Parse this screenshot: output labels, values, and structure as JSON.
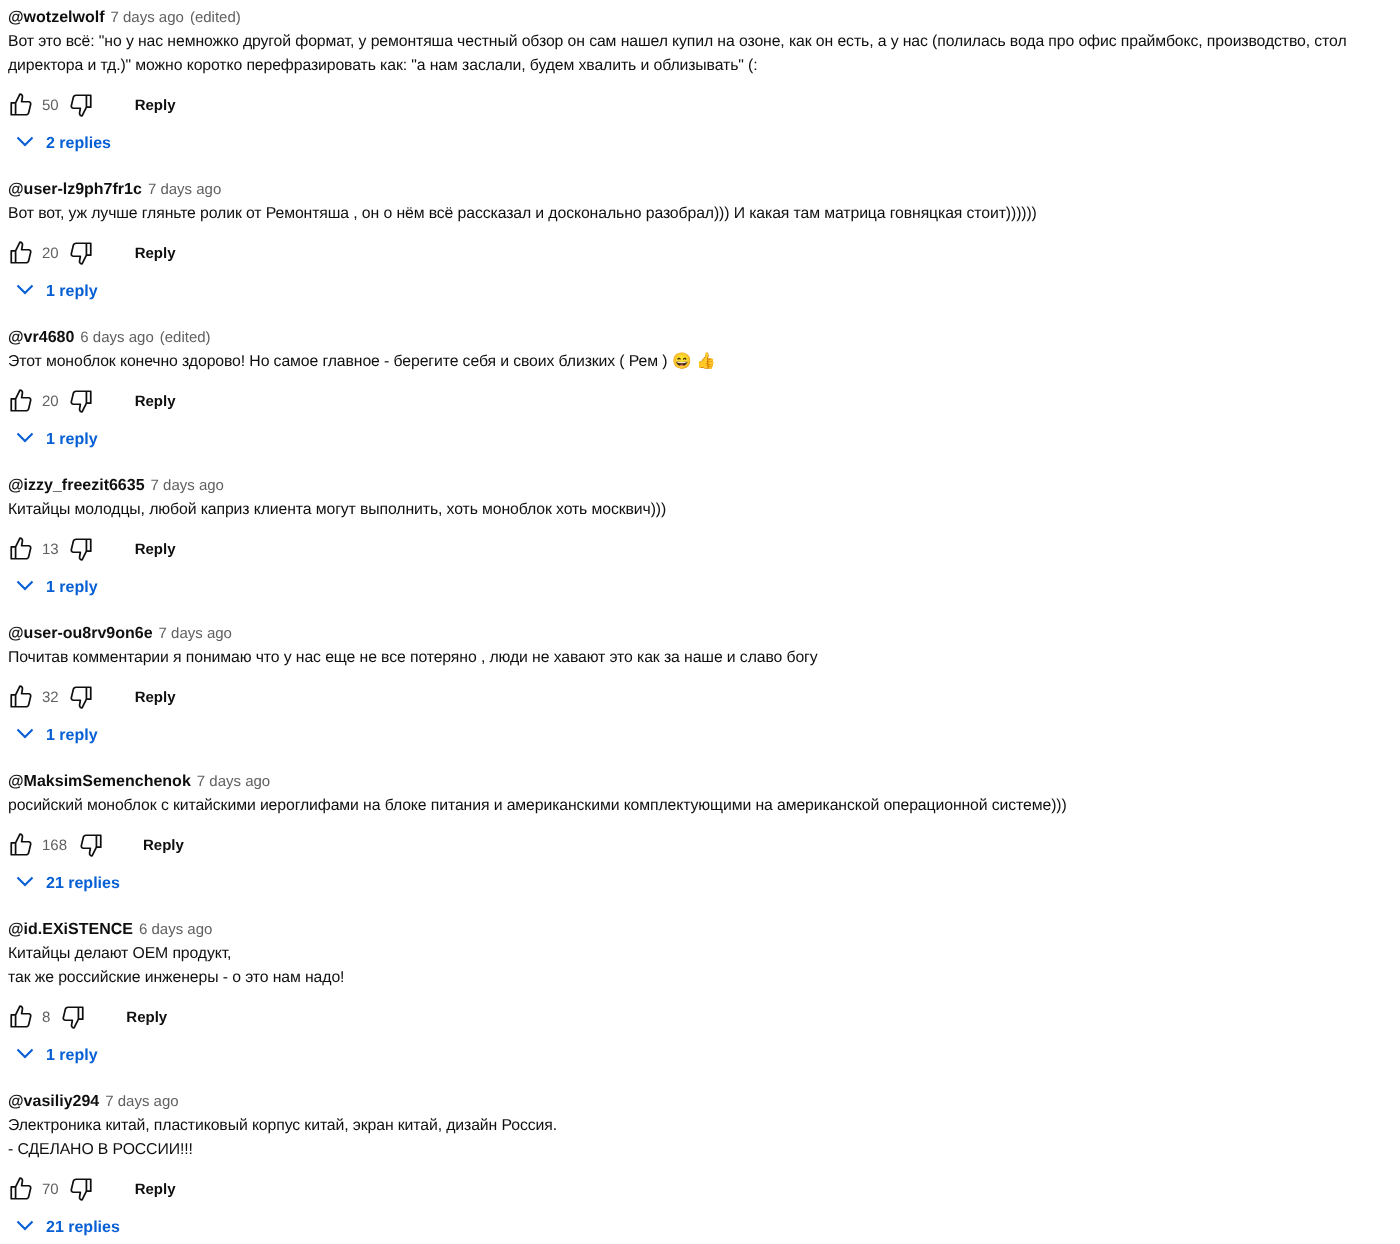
{
  "comments": [
    {
      "author": "@wotzelwolf",
      "time": "7 days ago",
      "edited": "(edited)",
      "lines": [
        "Вот это всё: \"но у нас немножко другой формат, у ремонтяша честный обзор он сам нашел купил на озоне, как он есть, а у нас (полилась вода про офис праймбокс, производство, стол",
        "директора и тд.)\" можно коротко перефразировать как: \"а нам заслали, будем хвалить и облизывать\" (:"
      ],
      "likes": "50",
      "reply": "Reply",
      "replies": "2 replies"
    },
    {
      "author": "@user-lz9ph7fr1c",
      "time": "7 days ago",
      "lines": [
        "Вот вот, уж лучше гляньте ролик от Ремонтяша , он о нём всё рассказал и досконально разобрал))) И какая там матрица говняцкая стоит))))))"
      ],
      "likes": "20",
      "reply": "Reply",
      "replies": "1 reply"
    },
    {
      "author": "@vr4680",
      "time": "6 days ago",
      "edited": "(edited)",
      "lines": [
        "Этот моноблок конечно здорово! Но самое главное - берегите себя и своих близких ( Рем ) 😄 👍"
      ],
      "likes": "20",
      "reply": "Reply",
      "replies": "1 reply"
    },
    {
      "author": "@izzy_freezit6635",
      "time": "7 days ago",
      "lines": [
        "Китайцы молодцы, любой каприз клиента могут выполнить, хоть моноблок хоть москвич)))"
      ],
      "likes": "13",
      "reply": "Reply",
      "replies": "1 reply"
    },
    {
      "author": "@user-ou8rv9on6e",
      "time": "7 days ago",
      "lines": [
        "Почитав комментарии я понимаю что у нас еще не все потеряно , люди не хавают это как за наше и славо богу"
      ],
      "likes": "32",
      "reply": "Reply",
      "replies": "1 reply"
    },
    {
      "author": "@MaksimSemenchenok",
      "time": "7 days ago",
      "lines": [
        "росийский моноблок с китайскими иероглифами на блоке питания и американскими комплектующими на американской операционной системе)))"
      ],
      "likes": "168",
      "reply": "Reply",
      "replies": "21 replies"
    },
    {
      "author": "@id.EXiSTENCE",
      "time": "6 days ago",
      "lines": [
        "Китайцы делают OEM продукт,",
        "так же российские инженеры - о это нам надо!"
      ],
      "likes": "8",
      "reply": "Reply",
      "replies": "1 reply"
    },
    {
      "author": "@vasiliy294",
      "time": "7 days ago",
      "lines": [
        "Электроника китай, пластиковый корпус китай, экран китай, дизайн Россия.",
        "- СДЕЛАНО В РОССИИ!!!"
      ],
      "likes": "70",
      "reply": "Reply",
      "replies": "21 replies"
    }
  ]
}
